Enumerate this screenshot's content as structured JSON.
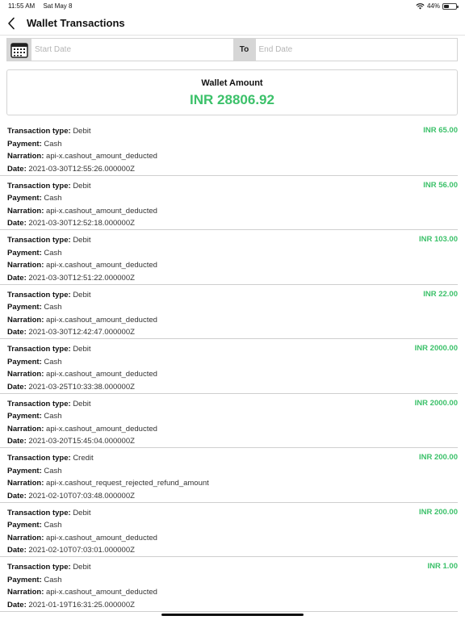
{
  "status_bar": {
    "time": "11:55 AM",
    "date": "Sat May 8",
    "battery": "44%",
    "battery_level": 0.44
  },
  "nav": {
    "title": "Wallet Transactions",
    "back_icon": "chevron-left-icon"
  },
  "date_filter": {
    "start_placeholder": "Start Date",
    "to_label": "To",
    "end_placeholder": "End Date",
    "calendar_icon": "calendar-icon"
  },
  "wallet": {
    "label": "Wallet Amount",
    "amount": "INR 28806.92",
    "amount_color": "#3cc16a"
  },
  "labels": {
    "type": "Transaction type:",
    "payment": "Payment:",
    "narration": "Narration:",
    "date": "Date:"
  },
  "transactions": [
    {
      "type": "Debit",
      "payment": "Cash",
      "narration": "api-x.cashout_amount_deducted",
      "date": "2021-03-30T12:55:26.000000Z",
      "amount": "INR 65.00"
    },
    {
      "type": "Debit",
      "payment": "Cash",
      "narration": "api-x.cashout_amount_deducted",
      "date": "2021-03-30T12:52:18.000000Z",
      "amount": "INR 56.00"
    },
    {
      "type": "Debit",
      "payment": "Cash",
      "narration": "api-x.cashout_amount_deducted",
      "date": "2021-03-30T12:51:22.000000Z",
      "amount": "INR 103.00"
    },
    {
      "type": "Debit",
      "payment": "Cash",
      "narration": "api-x.cashout_amount_deducted",
      "date": "2021-03-30T12:42:47.000000Z",
      "amount": "INR 22.00"
    },
    {
      "type": "Debit",
      "payment": "Cash",
      "narration": "api-x.cashout_amount_deducted",
      "date": "2021-03-25T10:33:38.000000Z",
      "amount": "INR 2000.00"
    },
    {
      "type": "Debit",
      "payment": "Cash",
      "narration": "api-x.cashout_amount_deducted",
      "date": "2021-03-20T15:45:04.000000Z",
      "amount": "INR 2000.00"
    },
    {
      "type": "Credit",
      "payment": "Cash",
      "narration": "api-x.cashout_request_rejected_refund_amount",
      "date": "2021-02-10T07:03:48.000000Z",
      "amount": "INR 200.00"
    },
    {
      "type": "Debit",
      "payment": "Cash",
      "narration": "api-x.cashout_amount_deducted",
      "date": "2021-02-10T07:03:01.000000Z",
      "amount": "INR 200.00"
    },
    {
      "type": "Debit",
      "payment": "Cash",
      "narration": "api-x.cashout_amount_deducted",
      "date": "2021-01-19T16:31:25.000000Z",
      "amount": "INR 1.00"
    }
  ]
}
